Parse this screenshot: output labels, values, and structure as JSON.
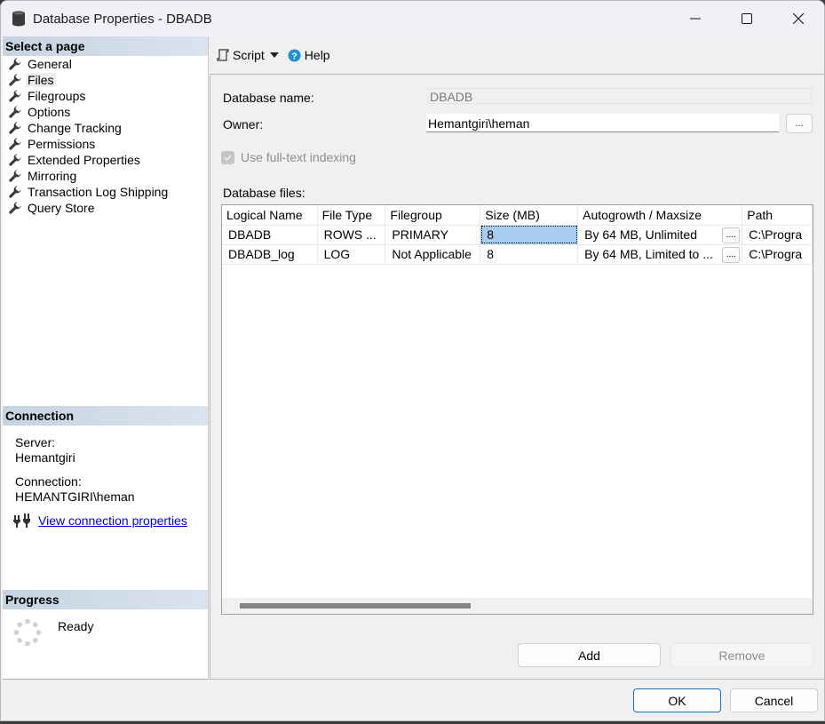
{
  "window": {
    "title": "Database Properties - DBADB",
    "icon": "database-icon",
    "controls": [
      "minimize-icon",
      "maximize-icon",
      "close-icon"
    ]
  },
  "left_pane": {
    "select_page_header": "Select a page",
    "pages": [
      {
        "label": "General",
        "icon": "wrench-icon",
        "selected": false
      },
      {
        "label": "Files",
        "icon": "wrench-icon",
        "selected": true
      },
      {
        "label": "Filegroups",
        "icon": "wrench-icon",
        "selected": false
      },
      {
        "label": "Options",
        "icon": "wrench-icon",
        "selected": false
      },
      {
        "label": "Change Tracking",
        "icon": "wrench-icon",
        "selected": false
      },
      {
        "label": "Permissions",
        "icon": "wrench-icon",
        "selected": false
      },
      {
        "label": "Extended Properties",
        "icon": "wrench-icon",
        "selected": false
      },
      {
        "label": "Mirroring",
        "icon": "wrench-icon",
        "selected": false
      },
      {
        "label": "Transaction Log Shipping",
        "icon": "wrench-icon",
        "selected": false
      },
      {
        "label": "Query Store",
        "icon": "wrench-icon",
        "selected": false
      }
    ],
    "connection": {
      "header": "Connection",
      "server_label": "Server:",
      "server_value": "Hemantgiri",
      "connection_label": "Connection:",
      "connection_value": "HEMANTGIRI\\heman",
      "view_link": "View connection properties"
    },
    "progress": {
      "header": "Progress",
      "status": "Ready"
    }
  },
  "toolbar": {
    "script_label": "Script",
    "help_label": "Help"
  },
  "form": {
    "database_name_label": "Database name:",
    "database_name_value": "DBADB",
    "owner_label": "Owner:",
    "owner_value": "Hemantgiri\\heman",
    "browse_label": "...",
    "fulltext_label": "Use full-text indexing",
    "fulltext_checked": true,
    "database_files_label": "Database files:"
  },
  "files_grid": {
    "columns": [
      "Logical Name",
      "File Type",
      "Filegroup",
      "Size (MB)",
      "Autogrowth / Maxsize",
      "Path"
    ],
    "rows": [
      {
        "logical_name": "DBADB",
        "file_type": "ROWS ...",
        "filegroup": "PRIMARY",
        "size_mb": "8",
        "autogrowth": "By 64 MB, Unlimited",
        "path": "C:\\Progra"
      },
      {
        "logical_name": "DBADB_log",
        "file_type": "LOG",
        "filegroup": "Not Applicable",
        "size_mb": "8",
        "autogrowth": "By 64 MB, Limited to ...",
        "path": "C:\\Progra"
      }
    ],
    "cell_button_label": "...."
  },
  "buttons": {
    "add": "Add",
    "remove": "Remove",
    "ok": "OK",
    "cancel": "Cancel"
  },
  "colors": {
    "header_gradient_start": "#c6d3e1",
    "selected_cell": "#a6cdef",
    "link": "#0000ee"
  }
}
